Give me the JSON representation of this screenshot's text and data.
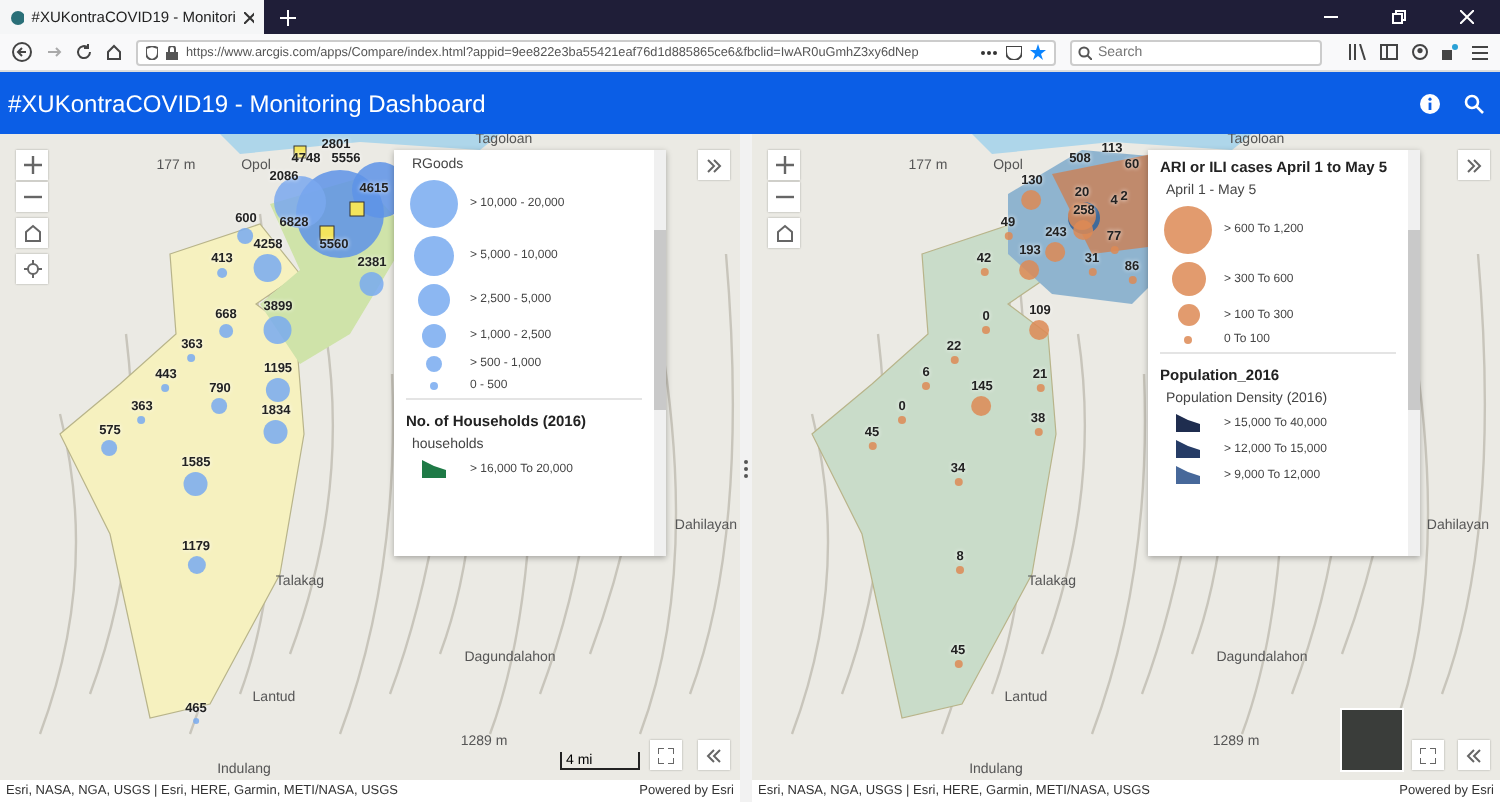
{
  "browser": {
    "tab_title": "#XUKontraCOVID19 - Monitori",
    "url": "https://www.arcgis.com/apps/Compare/index.html?appid=9ee822e3ba55421eaf76d1d885865ce6&fbclid=IwAR0uGmhZ3xy6dNep",
    "search_placeholder": "Search"
  },
  "header": {
    "title": "#XUKontraCOVID19 - Monitoring Dashboard"
  },
  "maps": [
    {
      "kind": "households",
      "place_labels": [
        "Tagoloan",
        "Opol",
        "177 m",
        "Talakag",
        "Dahilayan",
        "Dagundalahon",
        "Lantud",
        "1289 m",
        "Indulang"
      ],
      "value_labels": [
        "2801",
        "4748",
        "5556",
        "2086",
        "4615",
        "600",
        "6828",
        "4258",
        "5560",
        "413",
        "2381",
        "3899",
        "668",
        "363",
        "1195",
        "443",
        "790",
        "363",
        "1834",
        "575",
        "1585",
        "1179",
        "465"
      ],
      "legend": [
        {
          "subtitle": "RGoods",
          "items": [
            {
              "kind": "circle",
              "label": "> 10,000 - 20,000"
            },
            {
              "kind": "circle",
              "label": "> 5,000 - 10,000"
            },
            {
              "kind": "circle",
              "label": "> 2,500 - 5,000"
            },
            {
              "kind": "circle",
              "label": "> 1,000 - 2,500"
            },
            {
              "kind": "circle",
              "label": "> 500 - 1,000"
            },
            {
              "kind": "circle",
              "label": "0 - 500"
            }
          ]
        },
        {
          "title": "No. of Households (2016)",
          "subtitle": "households",
          "items": [
            {
              "kind": "swatch",
              "label": "> 16,000 To 20,000",
              "color": "#1e7a46"
            }
          ]
        }
      ],
      "scale": "4 mi",
      "attribution": "Esri, NASA, NGA, USGS | Esri, HERE, Garmin, METI/NASA, USGS",
      "powered": "Powered by Esri"
    },
    {
      "kind": "cases",
      "place_labels": [
        "Tagoloan",
        "Opol",
        "177 m",
        "Talakag",
        "Dahilayan",
        "Dagundalahon",
        "Lantud",
        "1289 m",
        "Indulang"
      ],
      "value_labels": [
        "508",
        "113",
        "60",
        "130",
        "20",
        "4",
        "2",
        "258",
        "49",
        "243",
        "77",
        "42",
        "193",
        "31",
        "86",
        "0",
        "109",
        "22",
        "6",
        "145",
        "21",
        "0",
        "38",
        "45",
        "34",
        "8",
        "45"
      ],
      "legend": [
        {
          "title": "ARI or ILI cases April 1 to May 5",
          "subtitle": "April 1 - May 5",
          "items": [
            {
              "kind": "circle",
              "label": "> 600 To 1,200"
            },
            {
              "kind": "circle",
              "label": "> 300 To 600"
            },
            {
              "kind": "circle",
              "label": "> 100 To 300"
            },
            {
              "kind": "circle",
              "label": "0 To 100"
            }
          ]
        },
        {
          "title": "Population_2016",
          "subtitle": "Population Density (2016)",
          "items": [
            {
              "kind": "swatch",
              "label": "> 15,000 To 40,000",
              "color": "#1f2d4f"
            },
            {
              "kind": "swatch",
              "label": "> 12,000 To 15,000",
              "color": "#263c66"
            },
            {
              "kind": "swatch",
              "label": "> 9,000 To 12,000",
              "color": "#47689a"
            }
          ]
        }
      ],
      "attribution": "Esri, NASA, NGA, USGS | Esri, HERE, Garmin, METI/NASA, USGS",
      "powered": "Powered by Esri"
    }
  ]
}
